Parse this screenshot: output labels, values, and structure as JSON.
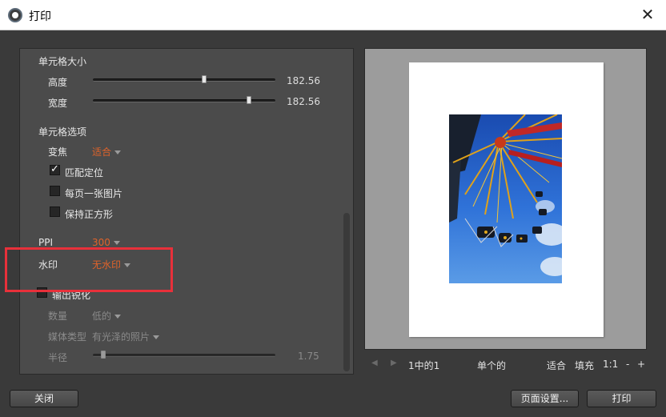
{
  "window": {
    "title": "打印",
    "close_glyph": "✕"
  },
  "settings": {
    "cell_size_heading": "单元格大小",
    "height": {
      "label": "高度",
      "value": "182.56",
      "level": 0.57
    },
    "width": {
      "label": "宽度",
      "value": "182.56",
      "level": 0.86
    },
    "cell_options_heading": "单元格选项",
    "zoom": {
      "label": "变焦",
      "value": "适合"
    },
    "checkboxes": [
      {
        "label": "匹配定位",
        "checked": true
      },
      {
        "label": "每页一张图片",
        "checked": false
      },
      {
        "label": "保持正方形",
        "checked": false
      }
    ],
    "ppi": {
      "label": "PPI",
      "value": "300"
    },
    "watermark": {
      "label": "水印",
      "value": "无水印"
    },
    "sharpen": {
      "label": "输出锐化",
      "checked": false
    },
    "amount": {
      "label": "数量",
      "value": "低的"
    },
    "media": {
      "label": "媒体类型",
      "value": "有光泽的照片"
    },
    "radius": {
      "label": "半径",
      "value": "1.75",
      "level": 0.02
    }
  },
  "preview_nav": {
    "prev_icon": "◀",
    "next_icon": "▶",
    "page_text": "1中的1",
    "mode_text": "单个的",
    "fit_label": "适合",
    "fill_label": "填充",
    "ratio_label": "1:1",
    "zoom_out_label": "-",
    "zoom_in_label": "+"
  },
  "buttons": {
    "close_label": "关闭",
    "page_setup_label": "页面设置...",
    "print_label": "打印"
  },
  "colors": {
    "accent_orange": "#e0632a",
    "highlight_red": "#e8303a"
  }
}
